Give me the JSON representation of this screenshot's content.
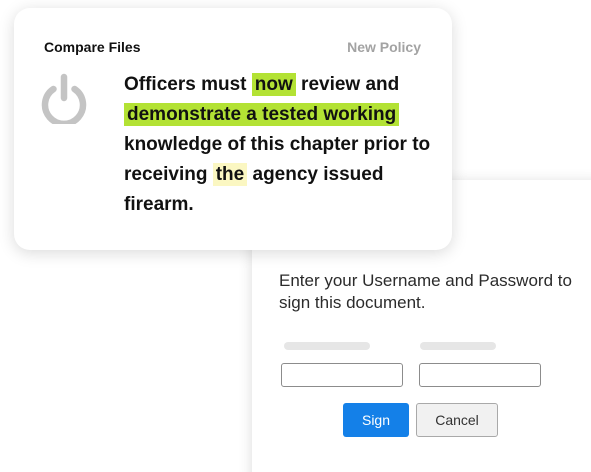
{
  "compare": {
    "title": "Compare Files",
    "policy_label": "New Policy",
    "icon": "power-icon",
    "text_segments": [
      {
        "text": "Officers must ",
        "highlight": "none"
      },
      {
        "text": "now",
        "highlight": "green"
      },
      {
        "text": " review and ",
        "highlight": "none"
      },
      {
        "text": "demonstrate a tested working",
        "highlight": "green"
      },
      {
        "text": " knowledge of this chapter prior to receiving ",
        "highlight": "none"
      },
      {
        "text": "the",
        "highlight": "yellow"
      },
      {
        "text": " agency issued firearm.",
        "highlight": "none"
      }
    ]
  },
  "sign_dialog": {
    "prompt": "Enter your Username and Password to sign this document.",
    "username_value": "",
    "password_value": "",
    "sign_label": "Sign",
    "cancel_label": "Cancel"
  },
  "colors": {
    "highlight_green": "#b3e234",
    "highlight_yellow": "#fbf7c2",
    "sign_button": "#1480e8",
    "policy_label": "#a3a3a3",
    "power_icon": "#c4c4c4"
  }
}
